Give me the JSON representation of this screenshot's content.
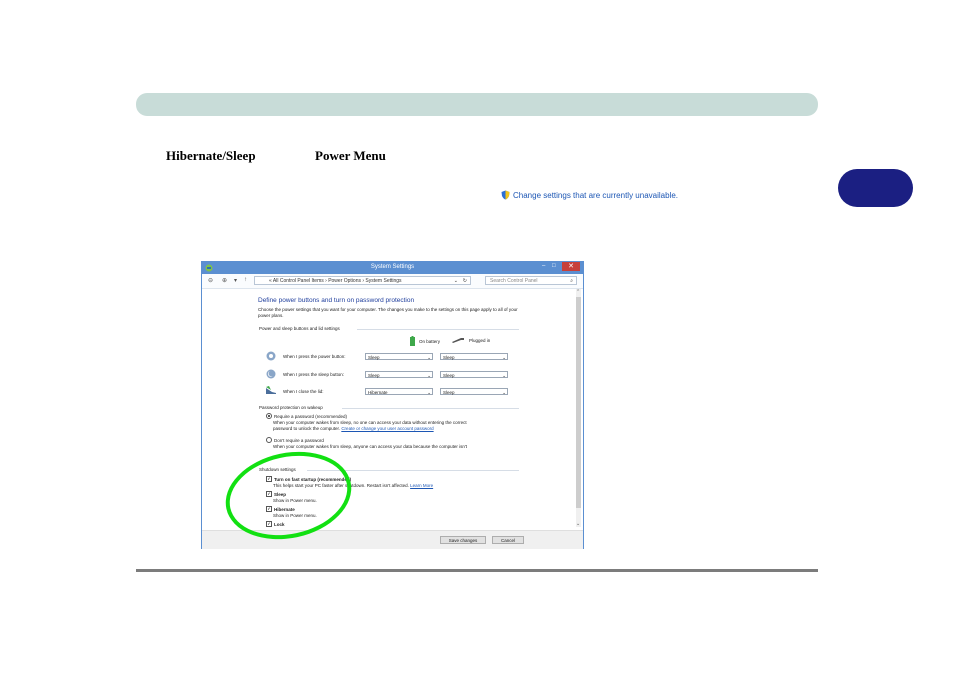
{
  "page": {
    "heading_left": "Hibernate/Sleep",
    "heading_right": "Power Menu",
    "change_settings_link": "Change settings that are currently unavailable."
  },
  "window": {
    "title": "System Settings",
    "controls": {
      "minimize": "–",
      "maximize": "□",
      "close": "✕"
    },
    "address": "« All Control Panel Items › Power Options › System Settings",
    "search_placeholder": "Search Control Panel",
    "main_title": "Define power buttons and turn on password protection",
    "description": "Choose the power settings that you want for your computer. The changes you make to the settings on this page apply to all of your power plans.",
    "section_power": "Power and sleep buttons and lid settings",
    "col_battery": "On battery",
    "col_plugged": "Plugged in",
    "rows": [
      {
        "label": "When I press the power button:",
        "battery": "Sleep",
        "plugged": "Sleep"
      },
      {
        "label": "When I press the sleep button:",
        "battery": "Sleep",
        "plugged": "Sleep"
      },
      {
        "label": "When I close the lid:",
        "battery": "Hibernate",
        "plugged": "Sleep"
      }
    ],
    "section_password": "Password protection on wakeup",
    "require_password": "Require a password (recommended)",
    "require_desc_1": "When your computer wakes from sleep, no one can access your data without entering the correct",
    "require_desc_2": "password to unlock the computer.",
    "require_link": "Create or change your user account password",
    "no_password": "Don't require a password",
    "no_password_desc": "When your computer wakes from sleep, anyone can access your data because the computer isn't",
    "section_shutdown": "Shutdown settings",
    "fast_startup": "Turn on fast startup (recommended)",
    "fast_startup_desc": "This helps start your PC faster after shutdown. Restart isn't affected.",
    "learn_more": "Learn More",
    "sleep": "Sleep",
    "sleep_desc": "Show in Power menu.",
    "hibernate": "Hibernate",
    "hibernate_desc": "Show in Power menu.",
    "lock": "Lock",
    "save_button": "Save changes",
    "cancel_button": "Cancel"
  },
  "colors": {
    "header_bar": "#c8dcd8",
    "chapter_tab": "#1b1f82",
    "highlight_ellipse": "#12e012",
    "window_accent": "#5b8fd1"
  }
}
